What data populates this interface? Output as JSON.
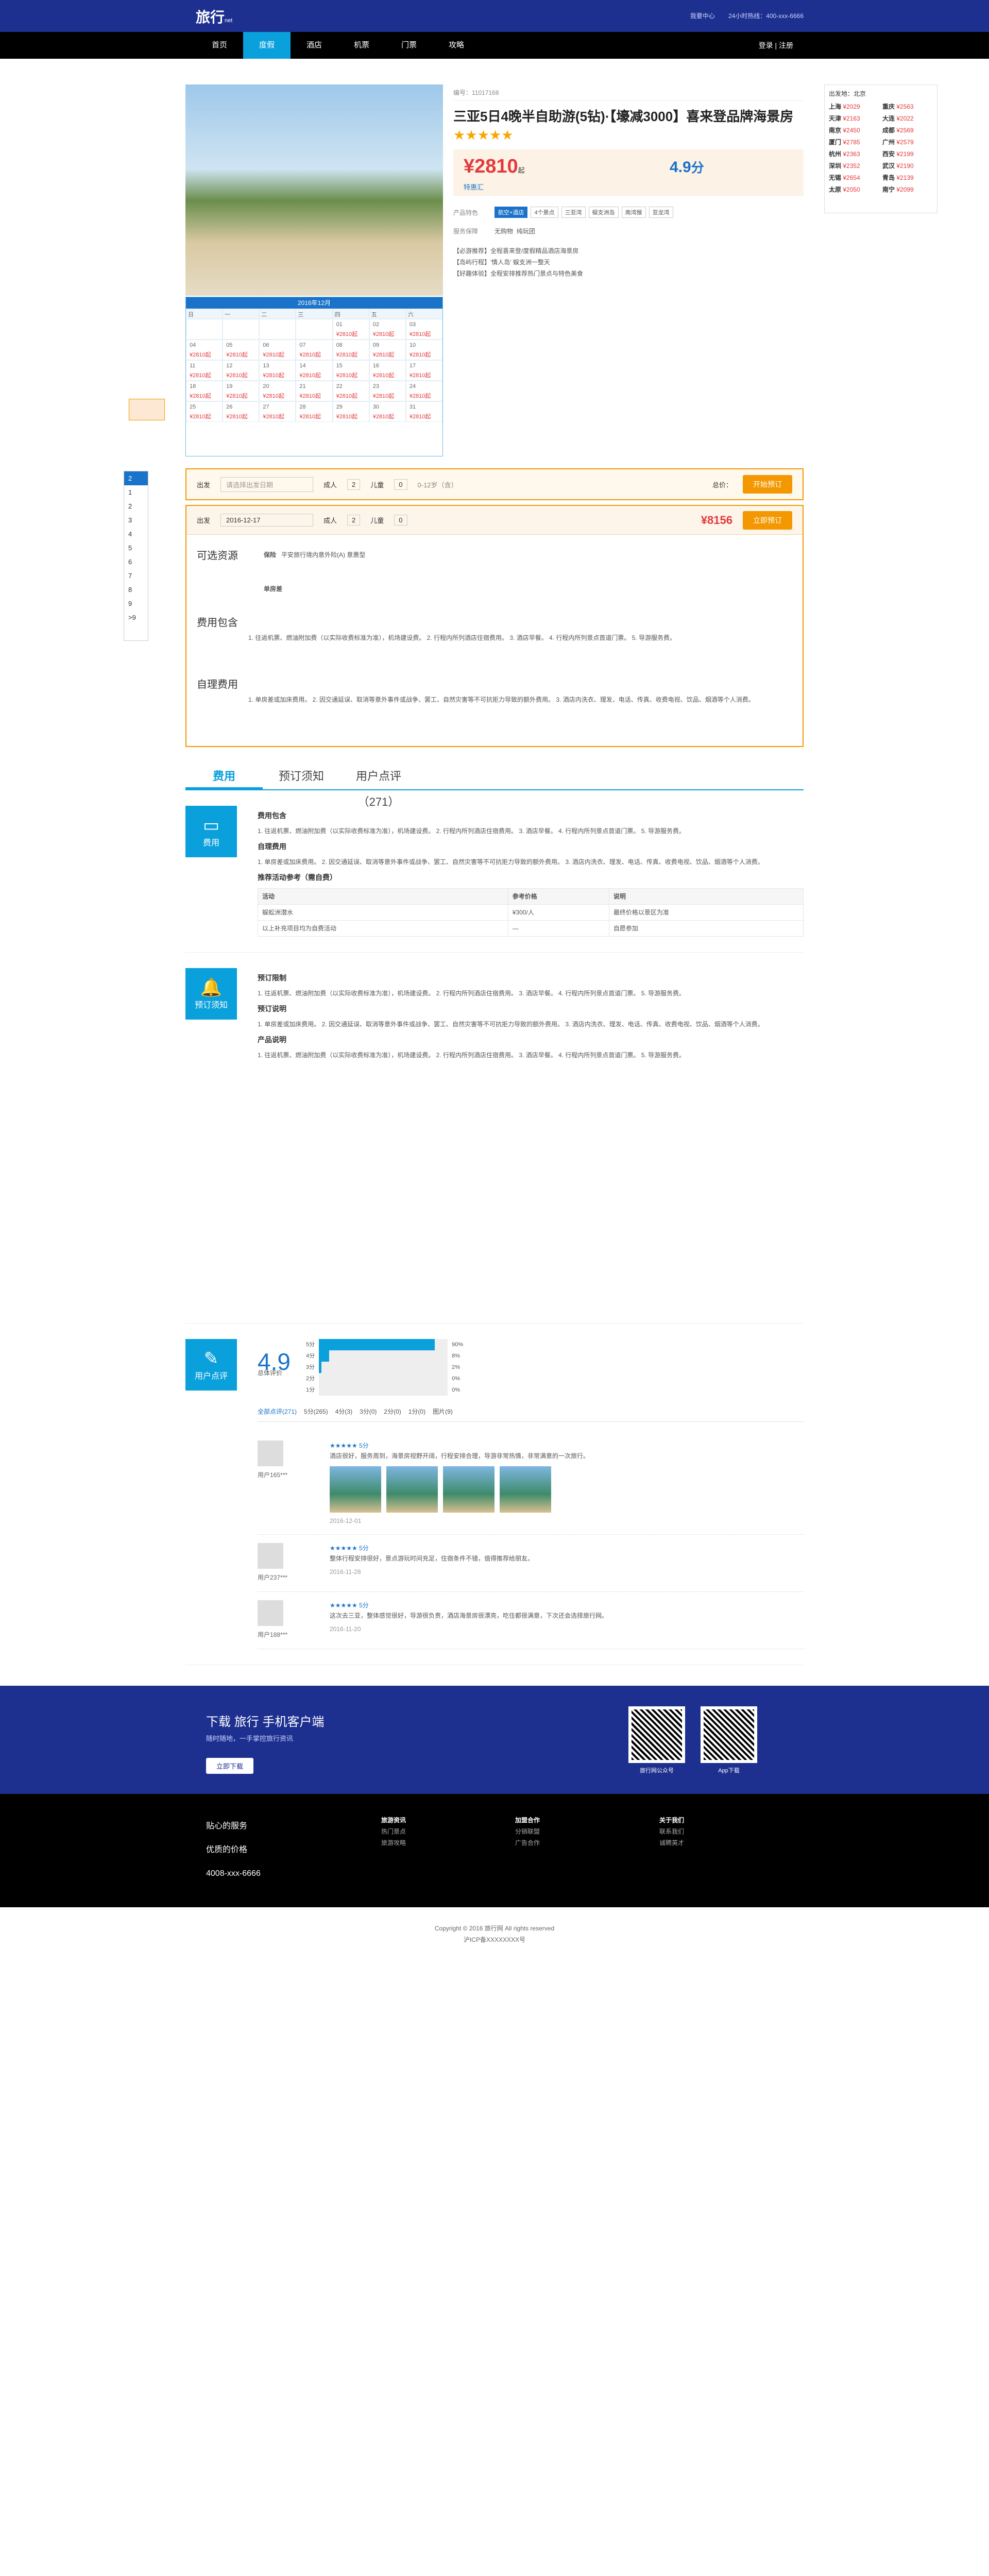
{
  "header": {
    "logo": "旅行",
    "logo_sub": "net",
    "links": [
      "我要中心",
      "24小时热线：400-xxx-6666"
    ],
    "login": "登录 | 注册"
  },
  "nav": [
    "首页",
    "度假",
    "酒店",
    "机票",
    "门票",
    "攻略"
  ],
  "product": {
    "code": "编号：11017168",
    "title": "三亚5日4晚半自助游(5钻)·【壕减3000】喜来登品牌海景房",
    "stars": "★★★★★",
    "price": "¥2810",
    "price_suffix": "起",
    "score": "4.9",
    "score_label": "分",
    "special": "特惠汇",
    "tags": [
      "航空+酒店",
      "4个景点",
      "三亚湾",
      "蜈支洲岛",
      "南湾猴",
      "亚龙湾"
    ],
    "service": "无购物",
    "tour": "纯玩团",
    "notes": [
      "【必游推荐】全程喜来登/度假精品酒店海景房",
      "【岛屿行程】'情人岛' 蜈支洲一整天",
      "【好趣体验】全程安排推荐热门景点与特色美食"
    ]
  },
  "calendar": {
    "month": "2016年12月",
    "week": [
      "日",
      "一",
      "二",
      "三",
      "四",
      "五",
      "六"
    ],
    "dates": [
      "",
      "",
      "",
      "",
      "01",
      "02",
      "03",
      "04",
      "05",
      "06",
      "07",
      "08",
      "09",
      "10",
      "11",
      "12",
      "13",
      "14",
      "15",
      "16",
      "17",
      "18",
      "19",
      "20",
      "21",
      "22",
      "23",
      "24",
      "25",
      "26",
      "27",
      "28",
      "29",
      "30",
      "31"
    ],
    "price": "¥2810起"
  },
  "side": {
    "title": "出发地：北京",
    "cities": [
      [
        "上海",
        "¥2029"
      ],
      [
        "重庆",
        "¥2563"
      ],
      [
        "天津",
        "¥2163"
      ],
      [
        "大连",
        "¥2022"
      ],
      [
        "南京",
        "¥2450"
      ],
      [
        "成都",
        "¥2569"
      ],
      [
        "厦门",
        "¥2785"
      ],
      [
        "广州",
        "¥2579"
      ],
      [
        "杭州",
        "¥2363"
      ],
      [
        "西安",
        "¥2199"
      ],
      [
        "深圳",
        "¥2352"
      ],
      [
        "武汉",
        "¥2190"
      ],
      [
        "无锡",
        "¥2654"
      ],
      [
        "青岛",
        "¥2139"
      ],
      [
        "太原",
        "¥2050"
      ],
      [
        "南宁",
        "¥2099"
      ]
    ]
  },
  "book": {
    "depart": "出发",
    "date_ph": "请选择出发日期",
    "adult": "成人",
    "child": "儿童",
    "adult_n": "2",
    "child_n": "0",
    "age": "0-12岁（含）",
    "total": "总价：",
    "btn": "开始预订",
    "date": "2016-12-17",
    "total_price": "¥8156",
    "btn2": "立即预订",
    "res_label": "可选资源",
    "ins": "保险",
    "ins_name": "平安旅行境内意外险(A) 意惠型",
    "single": "单房差",
    "fee_label": "费用包含",
    "self_label": "自理费用",
    "fee_text": "1. 往返机票、燃油附加费（以实际收费标准为准），机场建设费。 2. 行程内所列酒店住宿费用。 3. 酒店早餐。 4. 行程内所列景点首道门票。 5. 导游服务费。",
    "self_text": "1. 单房差或加床费用。 2. 因交通延误、取消等意外事件或战争、罢工、自然灾害等不可抗拒力导致的额外费用。 3. 酒店内洗衣、理发、电话、传真、收费电视、饮品、烟酒等个人消费。"
  },
  "dropdown": [
    "2",
    "1",
    "2",
    "3",
    "4",
    "5",
    "6",
    "7",
    "8",
    "9",
    ">9"
  ],
  "tabs": [
    "费用",
    "预订须知",
    "用户点评（271）"
  ],
  "sections": {
    "fee": "费用",
    "fee_h1": "费用包含",
    "fee_h2": "自理费用",
    "fee_h3": "推荐活动参考（需自费）",
    "notice": "预订须知",
    "notice_h1": "预订限制",
    "notice_h2": "预订说明",
    "notice_h3": "产品说明",
    "review": "用户点评",
    "total_score": "4.9",
    "total_label": "总体评价",
    "rating_rows": [
      [
        "5分",
        "90%"
      ],
      [
        "4分",
        "8%"
      ],
      [
        "3分",
        "2%"
      ],
      [
        "2分",
        "0%"
      ],
      [
        "1分",
        "0%"
      ]
    ]
  },
  "table": {
    "head": [
      "活动",
      "参考价格",
      "说明"
    ],
    "rows": [
      [
        "蜈蚣洲潜水",
        "¥300/人",
        "最终价格以景区为准"
      ],
      [
        "以上补充项目均为自费活动",
        "—",
        "自愿参加"
      ]
    ]
  },
  "reviews": {
    "tabs": [
      "全部点评(271)",
      "5分(265)",
      "4分(3)",
      "3分(0)",
      "2分(0)",
      "1分(0)",
      "图片(9)"
    ],
    "items": [
      {
        "user": "用户165***",
        "stars": "★★★★★ 5分",
        "text": "酒店很好，服务周到，海景房视野开阔，行程安排合理，导游非常热情，非常满意的一次旅行。",
        "date": "2016-12-01"
      },
      {
        "user": "用户237***",
        "stars": "★★★★★ 5分",
        "text": "整体行程安排很好，景点游玩时间充足，住宿条件不错，值得推荐给朋友。",
        "date": "2016-11-28"
      },
      {
        "user": "用户188***",
        "stars": "★★★★★ 5分",
        "text": "这次去三亚，整体感觉很好，导游很负责，酒店海景房很漂亮，吃住都很满意，下次还会选择旅行网。",
        "date": "2016-11-20"
      }
    ]
  },
  "app": {
    "title": "下载",
    "name": "手机客户端",
    "desc": "随时随地，一手掌控旅行资讯",
    "btn": "立即下载",
    "qr1": "旅行网公众号",
    "qr2": "App下载"
  },
  "footer": {
    "services": [
      "贴心的服务",
      "优质的价格",
      "4008-xxx-6666"
    ],
    "cols": [
      [
        "旅游资讯",
        "热门景点",
        "旅游攻略"
      ],
      [
        "加盟合作",
        "分销联盟",
        "广告合作"
      ],
      [
        "关于我们",
        "联系我们",
        "诚聘英才"
      ]
    ],
    "copy": "Copyright © 2016 旅行网 All rights reserved",
    "icp": "沪ICP备XXXXXXXX号"
  }
}
